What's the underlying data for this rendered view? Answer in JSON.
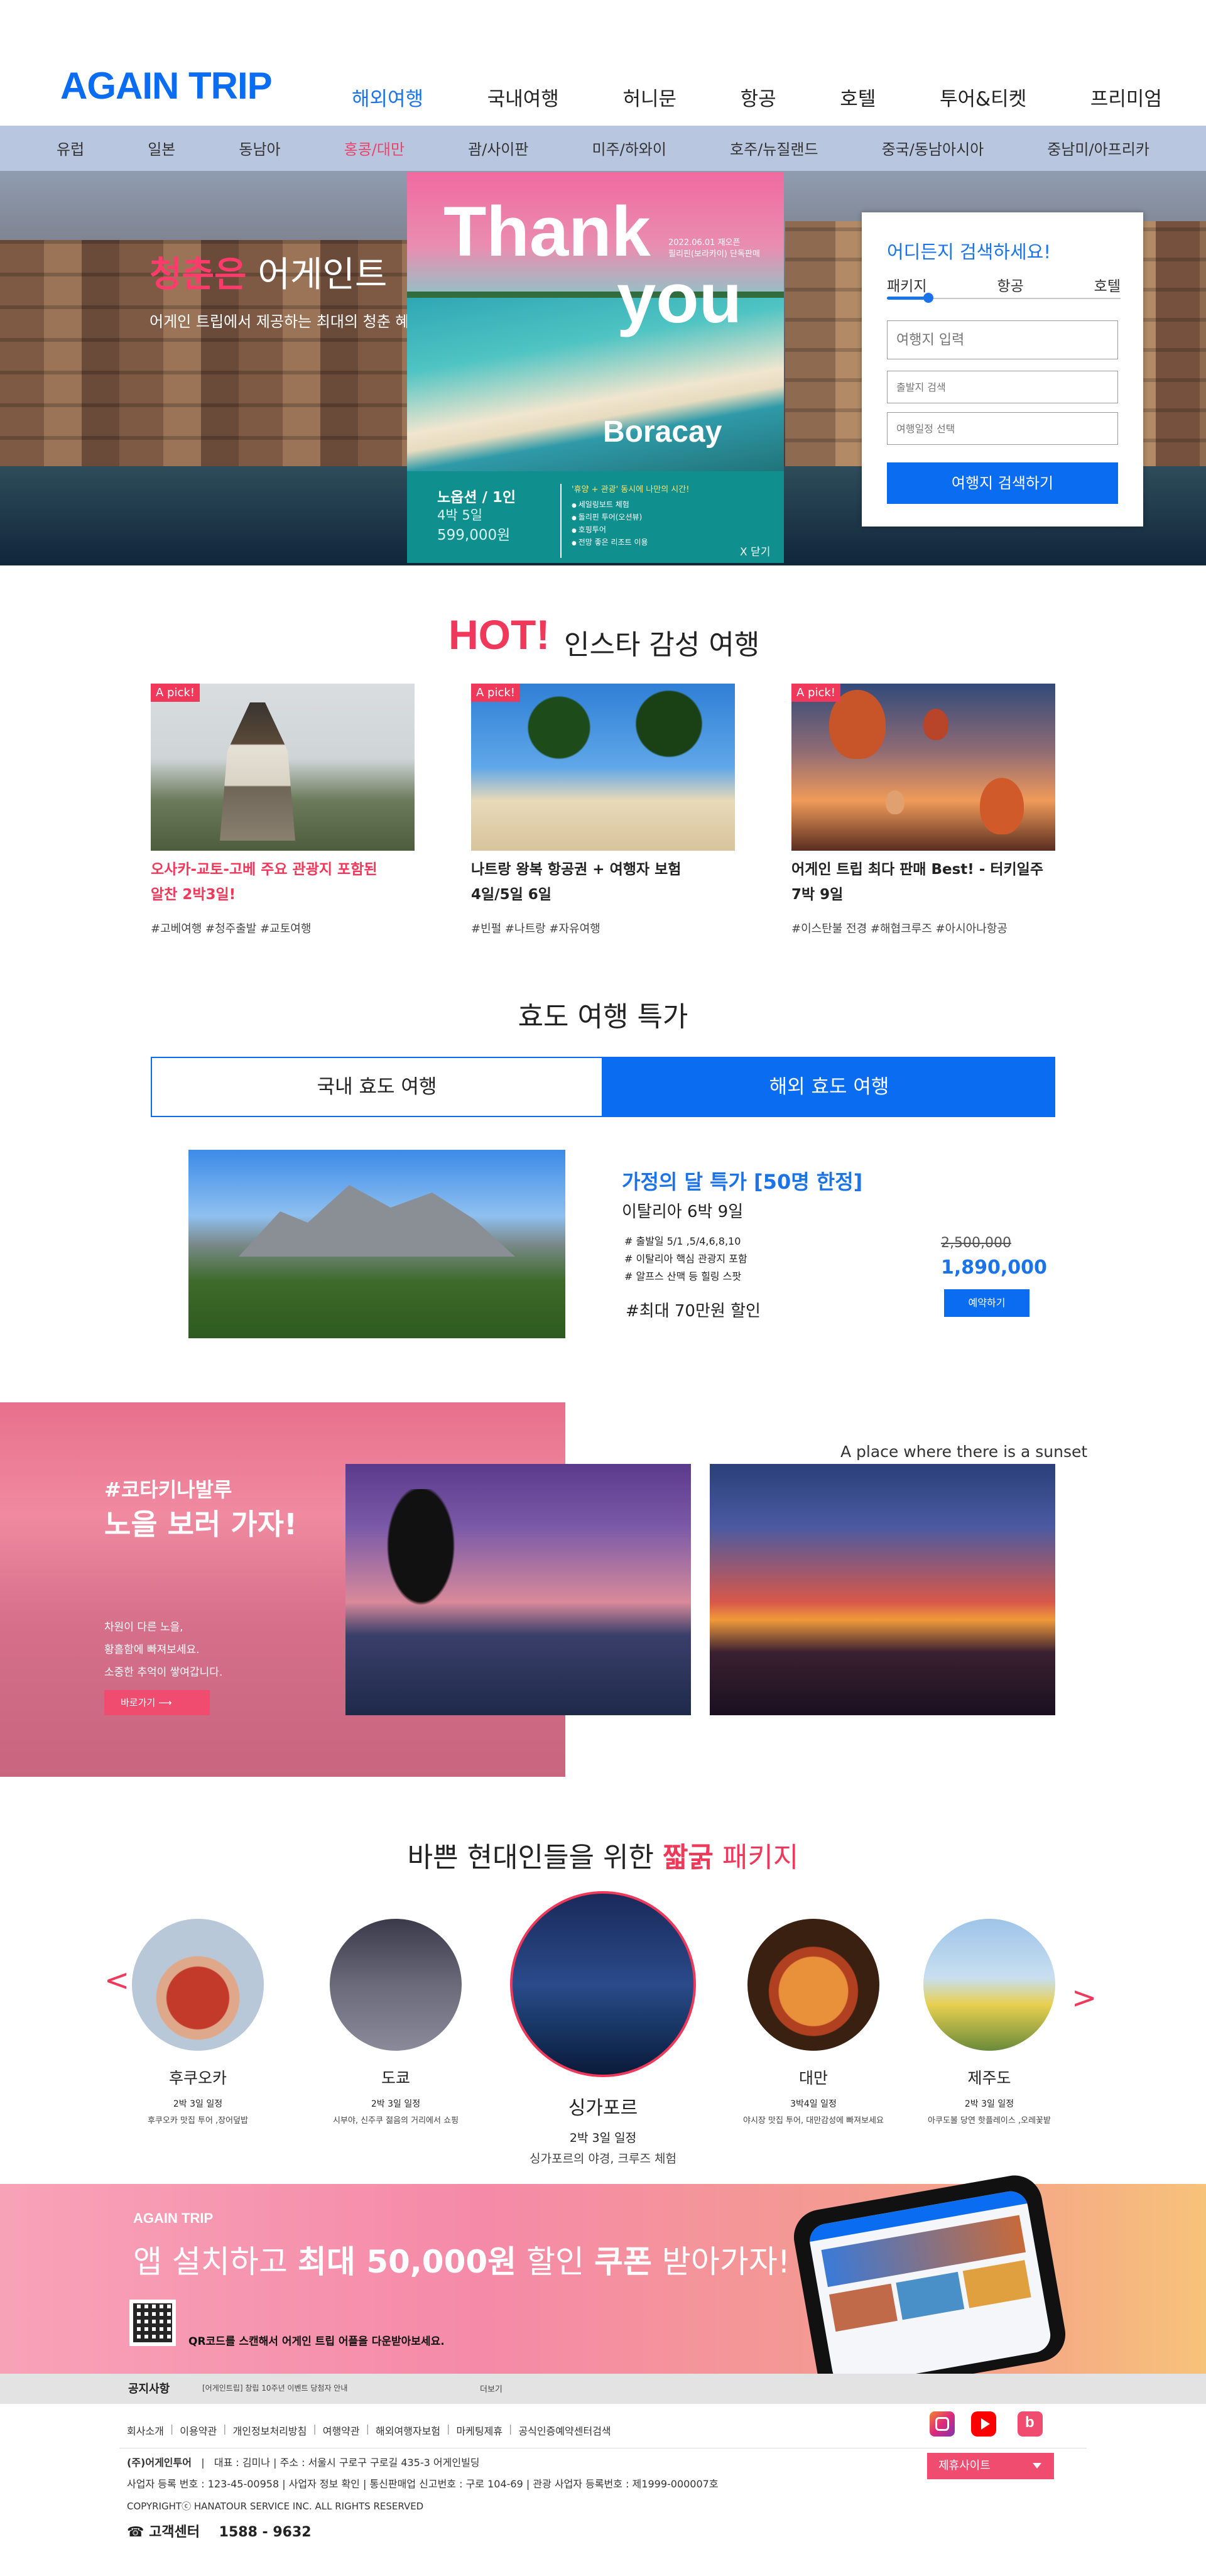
{
  "header": {
    "logo": "AGAIN TRIP",
    "nav": [
      "해외여행",
      "국내여행",
      "허니문",
      "항공",
      "호텔",
      "투어&티켓",
      "프리미엄"
    ],
    "active_nav": "해외여행",
    "subnav": [
      "유럽",
      "일본",
      "동남아",
      "홍콩/대만",
      "괌/사이판",
      "미주/하와이",
      "호주/뉴질랜드",
      "중국/동남아시아",
      "중남미/아프리카"
    ],
    "active_subnav": "홍콩/대만"
  },
  "hero": {
    "title_highlight": "청춘은",
    "title_rest": " 어게인트",
    "subtitle": "어게인 트립에서 제공하는 최대의 청춘 혜"
  },
  "popup": {
    "thank": "Thank",
    "you": "you",
    "date_line1": "2022.06.01 재오픈",
    "date_line2": "필리핀(보라카이) 단독판매",
    "destination": "Boracay",
    "airline": "노옵션 / 1인",
    "nights": "4박 5일",
    "price": "599,000원",
    "highlight": "'휴양 + 관광' 동시에 나만의 시간!",
    "features": [
      "세일링보트 체험",
      "돌리핀 투어(오션뷰)",
      "호핑투어",
      "전망 좋은 리조트 이용"
    ],
    "close": "X 닫기"
  },
  "search": {
    "title": "어디든지 검색하세요!",
    "tabs": [
      "패키지",
      "항공",
      "호텔"
    ],
    "destination_placeholder": "여행지 입력",
    "departure_placeholder": "출발지 검색",
    "date_placeholder": "여행일정 선택",
    "button": "여행지 검색하기"
  },
  "hot": {
    "badge_word": "HOT!",
    "title": "인스타 감성 여행",
    "cards": [
      {
        "badge": "A pick!",
        "line1": "오사카-교토-고베 주요 관광지 포함된",
        "line2": "알찬 2박3일!",
        "tags": "#고베여행 #청주출발 #교토여행"
      },
      {
        "badge": "A pick!",
        "line1": "나트랑 왕복 항공권 + 여행자 보험",
        "line2": "4일/5일 6일",
        "tags": "#빈펄 #나트랑 #자유여행"
      },
      {
        "badge": "A pick!",
        "line1": "어게인 트립 최다 판매 Best! - 터키일주",
        "line2": "7박 9일",
        "tags": "#이스탄불 전경 #해협크루즈 #아시아나항공"
      }
    ]
  },
  "hyodo": {
    "title": "효도 여행 특가",
    "tab_domestic": "국내 효도 여행",
    "tab_overseas": "해외 효도 여행",
    "deal_title": "가정의 달 특가 [50명 한정]",
    "deal_subtitle": "이탈리아 6박 9일",
    "deal_points": [
      "# 출발일 5/1 ,5/4,6,8,10",
      "# 이탈리아 핵심 관광지 포함",
      "# 알프스 산맥 등 힐링 스팟"
    ],
    "deal_discount": "#최대 70만원 할인",
    "original_price": "2,500,000",
    "sale_price": "1,890,000",
    "button": "예약하기"
  },
  "sunset": {
    "tag": "#코타키나발루",
    "title": "노을 보러 가자!",
    "body": [
      "차원이 다른 노을,",
      "황홀함에 빠져보세요.",
      "소중한 추억이 쌓여갑니다."
    ],
    "button": "바로가기",
    "caption": "A place where there is a sunset"
  },
  "packages": {
    "title_pre": "바쁜 현대인들을 위한 ",
    "title_highlight": "짧굵",
    "title_post": " 패키지",
    "prev": "<",
    "next": ">",
    "items": [
      {
        "name": "후쿠오카",
        "duration": "2박 3일 일정",
        "desc": "후쿠오카 맛집 투어 ,장어덮밥"
      },
      {
        "name": "도쿄",
        "duration": "2박 3일 일정",
        "desc": "시부야, 신주쿠 젊음의 거리에서 쇼핑"
      },
      {
        "name": "싱가포르",
        "duration": "2박 3일 일정",
        "desc": "싱가포르의 야경, 크루즈 체험"
      },
      {
        "name": "대만",
        "duration": "3박4일 일정",
        "desc": "야시장 맛집 투어, 대만감성에 빠져보세요"
      },
      {
        "name": "제주도",
        "duration": "2박 3일 일정",
        "desc": "아쿠도볼 당연 핫플레이스 ,오레꽃밭"
      }
    ]
  },
  "app_banner": {
    "brand": "AGAIN TRIP",
    "title_pre": "앱 설치하고 ",
    "title_bold": "최대 50,000원",
    "title_mid": " 할인 ",
    "title_bold2": "쿠폰",
    "title_post": " 받아가자!",
    "qr_text": "QR코드를 스캔해서 어게인 트립 어플을 다운받아보세요."
  },
  "notice": {
    "label": "공지사항",
    "text": "[어게인트립] 창립 10주년 이벤트 당첨자 안내",
    "more": "더보기"
  },
  "footer": {
    "links": [
      "회사소개",
      "이용약관",
      "개인정보처리방침",
      "여행약관",
      "해외여행자보험",
      "마케팅제휴",
      "공식인증예약센터검색"
    ],
    "company": "(주)어게인투어",
    "company_info": "대표 : 김미나   |   주소 : 서울시 구로구 구로길 435-3 어게인빌딩",
    "business_line": "사업자 등록 번호 : 123-45-00958   |   사업자 정보 확인   |   통신판매업 신고번호 : 구로 104-69   |   관광 사업자 등록번호 : 제1999-000007호",
    "copyright": "COPYRIGHTⓒ HANATOUR SERVICE INC. ALL RIGHTS RESERVED",
    "cs_label": "☎ 고객센터",
    "cs_number": "1588 - 9632",
    "family_site": "제휴사이트"
  },
  "colors": {
    "brand_blue": "#0a6cf0",
    "accent_pink": "#f0385a"
  }
}
